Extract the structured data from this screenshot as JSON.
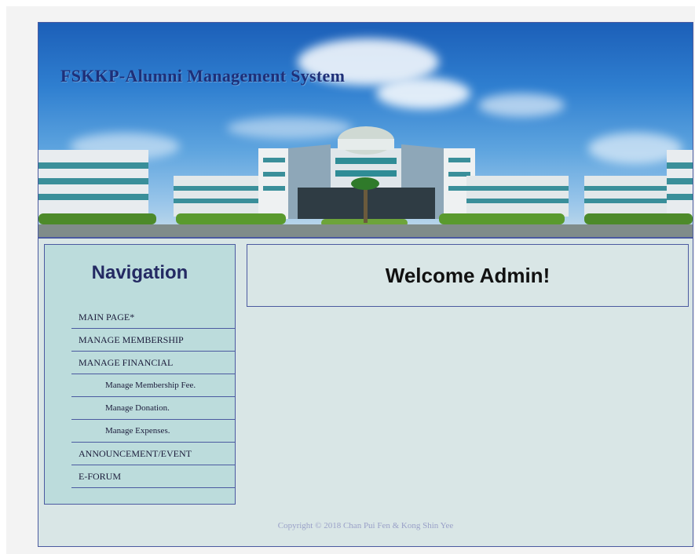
{
  "banner": {
    "title": "FSKKP-Alumni Management System"
  },
  "sidebar": {
    "title": "Navigation",
    "items": [
      {
        "label": "MAIN PAGE*",
        "sub": false
      },
      {
        "label": "MANAGE MEMBERSHIP",
        "sub": false
      },
      {
        "label": "MANAGE FINANCIAL",
        "sub": false
      },
      {
        "label": "Manage Membership Fee.",
        "sub": true
      },
      {
        "label": "Manage Donation.",
        "sub": true
      },
      {
        "label": "Manage Expenses.",
        "sub": true
      },
      {
        "label": "ANNOUNCEMENT/EVENT",
        "sub": false
      },
      {
        "label": "E-FORUM",
        "sub": false
      }
    ]
  },
  "main": {
    "welcome": "Welcome Admin!"
  },
  "footer": {
    "copyright": "Copyright © 2018 Chan Pui Fen & Kong Shin Yee"
  },
  "colors": {
    "border": "#4b5aa0",
    "sidebar_bg": "#bcdcdc",
    "content_bg": "#d9e6e6",
    "title_color": "#1e2f78"
  }
}
